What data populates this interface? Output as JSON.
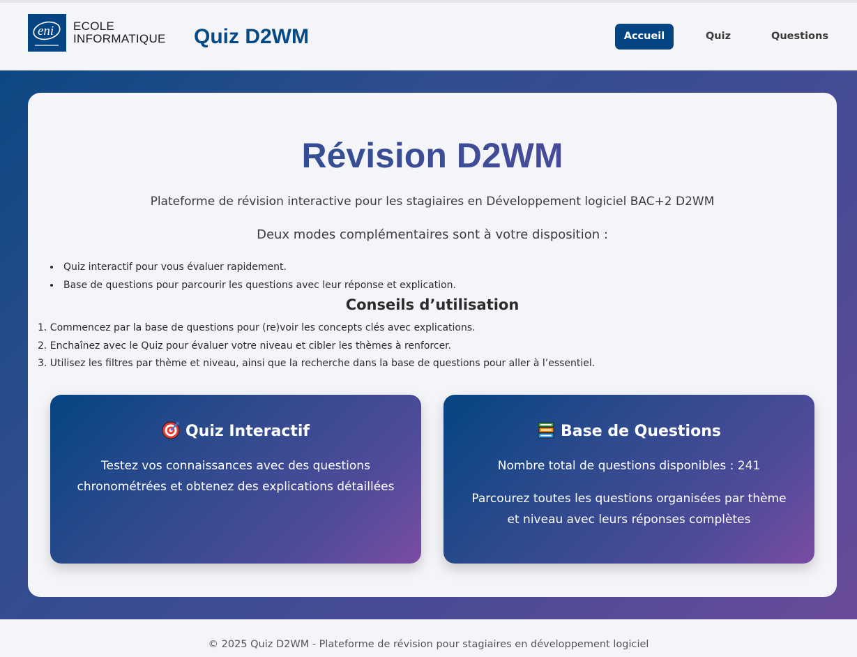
{
  "brand": {
    "logo_mark": "eni",
    "logo_line1": "ECOLE",
    "logo_line2": "INFORMATIQUE",
    "app_title": "Quiz D2WM"
  },
  "nav": {
    "items": [
      {
        "label": "Accueil",
        "active": true
      },
      {
        "label": "Quiz",
        "active": false
      },
      {
        "label": "Questions",
        "active": false
      }
    ]
  },
  "main": {
    "title": "Révision D2WM",
    "subtitle": "Plateforme de révision interactive pour les stagiaires en Développement logiciel BAC+2 D2WM",
    "modes_intro": "Deux modes complémentaires sont à votre disposition :",
    "modes": [
      "Quiz interactif pour vous évaluer rapidement.",
      "Base de questions pour parcourir les questions avec leur réponse et explication."
    ],
    "tips_title": "Conseils d’utilisation",
    "tips": [
      "1. Commencez par la base de questions pour (re)voir les concepts clés avec explications.",
      "2. Enchaînez avec le Quiz pour évaluer votre niveau et cibler les thèmes à renforcer.",
      "3. Utilisez les filtres par thème et niveau, ainsi que la recherche dans la base de questions pour aller à l’essentiel."
    ]
  },
  "cards": {
    "quiz": {
      "icon": "target-icon",
      "title": "Quiz Interactif",
      "text": "Testez vos connaissances avec des questions chronométrées et obtenez des explications détaillées"
    },
    "questions": {
      "icon": "books-icon",
      "title": "Base de Questions",
      "count_text": "Nombre total de questions disponibles : 241",
      "text": "Parcourez toutes les questions organisées par thème et niveau avec leurs réponses complètes"
    }
  },
  "footer": {
    "text": "© 2025 Quiz D2WM - Plateforme de révision pour stagiaires en développement logiciel"
  },
  "colors": {
    "primary": "#054482",
    "gradient_start": "#0d4783",
    "gradient_end": "#6a4b9b",
    "background": "#f4f5f9"
  }
}
